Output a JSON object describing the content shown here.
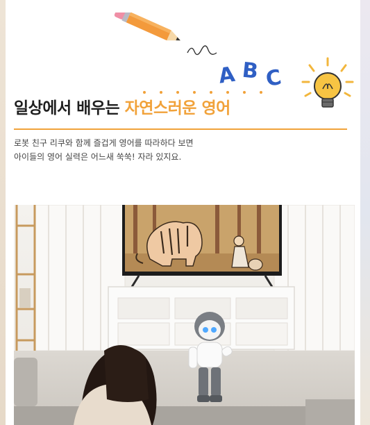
{
  "heading": {
    "prefix": "일상에서 배우는 ",
    "highlight": "자연스러운 영어"
  },
  "description": {
    "line1": "로봇 친구 리쿠와 함께 즐겁게 영어를 따라하다 보면",
    "line2": "아이들의 영어 실력은 어느새 쑥쑥! 자라 있지요."
  },
  "illustrations": {
    "abc_letters": "ABC",
    "icons": [
      "pencil-icon",
      "lightbulb-icon"
    ]
  },
  "colors": {
    "accent": "#f1a23a",
    "abc_blue": "#2f5fc4"
  }
}
